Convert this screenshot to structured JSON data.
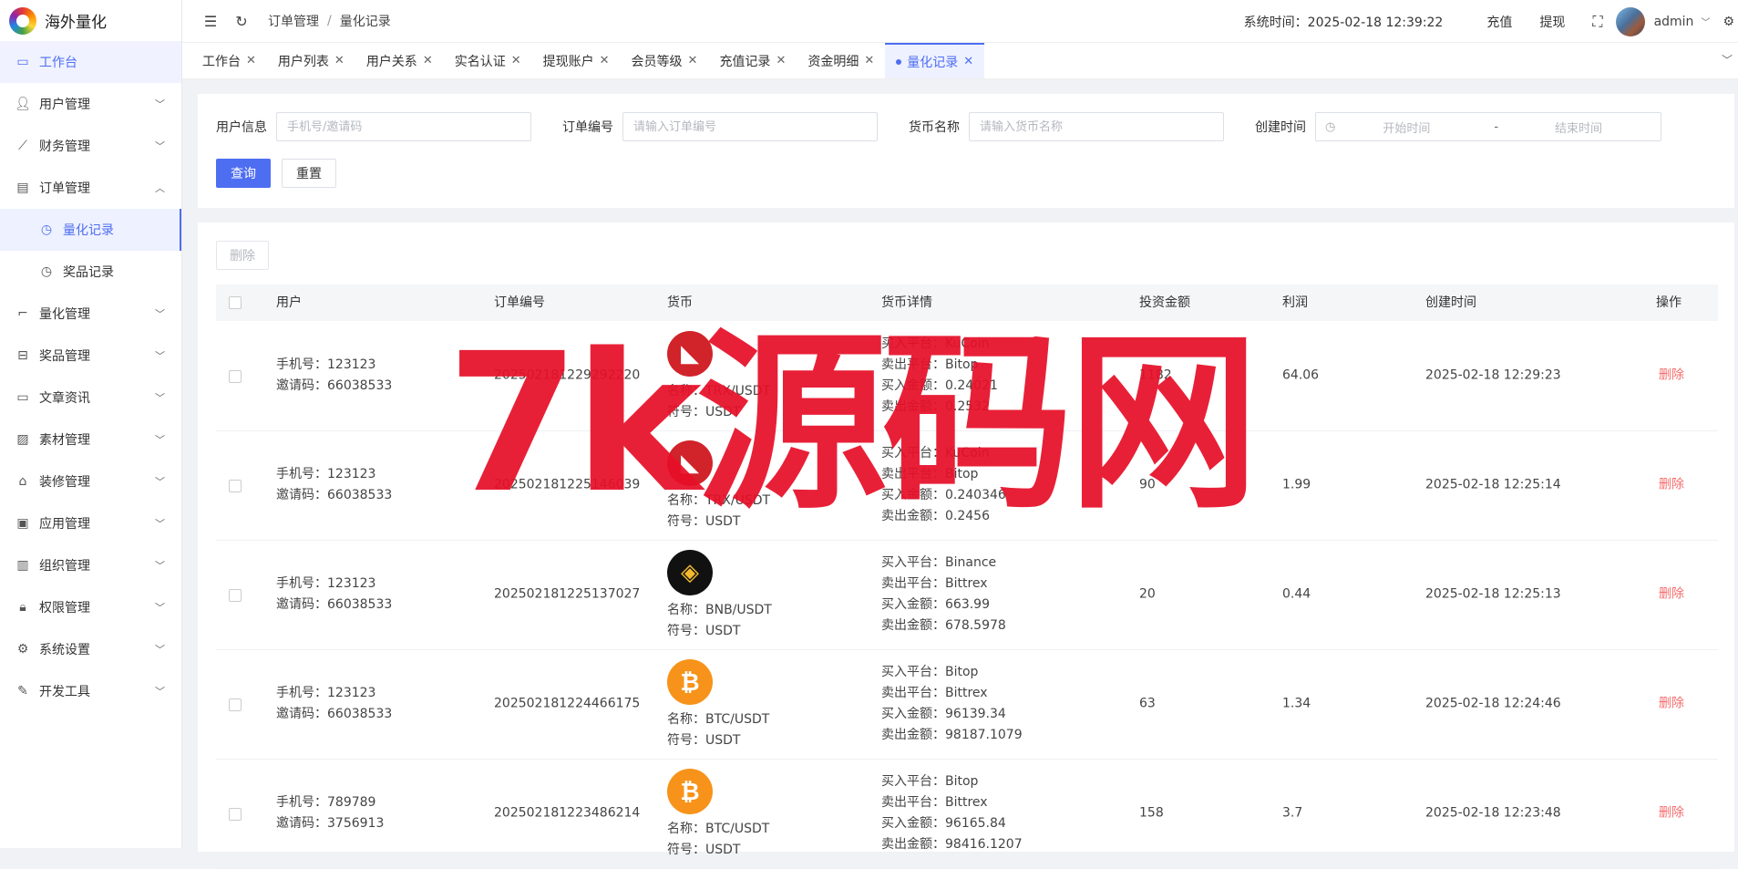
{
  "app": {
    "title": "海外量化"
  },
  "sidebar": {
    "items": [
      {
        "label": "工作台",
        "icon": "monitor-icon"
      },
      {
        "label": "用户管理",
        "icon": "user-icon"
      },
      {
        "label": "财务管理",
        "icon": "chart-icon"
      },
      {
        "label": "订单管理",
        "icon": "order-icon",
        "expanded": true,
        "children": [
          {
            "label": "量化记录",
            "icon": "clock-icon",
            "selected": true
          },
          {
            "label": "奖品记录",
            "icon": "clock-icon"
          }
        ]
      },
      {
        "label": "量化管理",
        "icon": "quant-icon"
      },
      {
        "label": "奖品管理",
        "icon": "gift-icon"
      },
      {
        "label": "文章资讯",
        "icon": "article-icon"
      },
      {
        "label": "素材管理",
        "icon": "image-icon"
      },
      {
        "label": "装修管理",
        "icon": "decorate-icon"
      },
      {
        "label": "应用管理",
        "icon": "app-icon"
      },
      {
        "label": "组织管理",
        "icon": "org-icon"
      },
      {
        "label": "权限管理",
        "icon": "lock-icon"
      },
      {
        "label": "系统设置",
        "icon": "gear-icon"
      },
      {
        "label": "开发工具",
        "icon": "tool-icon"
      }
    ]
  },
  "header": {
    "breadcrumb": [
      "订单管理",
      "量化记录"
    ],
    "breadcrumb_sep": "/",
    "system_time": "系统时间：2025-02-18 12:39:22",
    "recharge": "充值",
    "withdraw": "提现",
    "user": "admin"
  },
  "tabs": [
    "工作台",
    "用户列表",
    "用户关系",
    "实名认证",
    "提现账户",
    "会员等级",
    "充值记录",
    "资金明细",
    "量化记录"
  ],
  "search": {
    "user_label": "用户信息",
    "user_placeholder": "手机号/邀请码",
    "order_label": "订单编号",
    "order_placeholder": "请输入订单编号",
    "coin_label": "货币名称",
    "coin_placeholder": "请输入货币名称",
    "time_label": "创建时间",
    "time_start": "开始时间",
    "time_sep": "-",
    "time_end": "结束时间",
    "query_btn": "查询",
    "reset_btn": "重置"
  },
  "table": {
    "delete_btn": "删除",
    "columns": [
      "用户",
      "订单编号",
      "货币",
      "货币详情",
      "投资金额",
      "利润",
      "创建时间",
      "操作"
    ],
    "rows": [
      {
        "phone": "手机号：123123",
        "invite": "邀请码：66038533",
        "order_no": "202502181229292220",
        "coin_icon": "tron-icon",
        "coin_name": "名称：TRX/USDT",
        "coin_symbol": "符号：USDT",
        "buy_platform": "买入平台：KuCoin",
        "sell_platform": "卖出平台：Bitop",
        "buy_amount": "买入金额：0.24021",
        "sell_amount": "卖出金额：0.2532",
        "invest": "1182",
        "profit": "64.06",
        "created": "2025-02-18 12:29:23",
        "action": "删除"
      },
      {
        "phone": "手机号：123123",
        "invite": "邀请码：66038533",
        "order_no": "202502181225146039",
        "coin_icon": "tron-icon",
        "coin_name": "名称：TRX/USDT",
        "coin_symbol": "符号：USDT",
        "buy_platform": "买入平台：KuCoin",
        "sell_platform": "卖出平台：Bitop",
        "buy_amount": "买入金额：0.240346",
        "sell_amount": "卖出金额：0.2456",
        "invest": "90",
        "profit": "1.99",
        "created": "2025-02-18 12:25:14",
        "action": "删除"
      },
      {
        "phone": "手机号：123123",
        "invite": "邀请码：66038533",
        "order_no": "202502181225137027",
        "coin_icon": "bnb-icon",
        "coin_name": "名称：BNB/USDT",
        "coin_symbol": "符号：USDT",
        "buy_platform": "买入平台：Binance",
        "sell_platform": "卖出平台：Bittrex",
        "buy_amount": "买入金额：663.99",
        "sell_amount": "卖出金额：678.5978",
        "invest": "20",
        "profit": "0.44",
        "created": "2025-02-18 12:25:13",
        "action": "删除"
      },
      {
        "phone": "手机号：123123",
        "invite": "邀请码：66038533",
        "order_no": "202502181224466175",
        "coin_icon": "bitcoin-icon",
        "coin_name": "名称：BTC/USDT",
        "coin_symbol": "符号：USDT",
        "buy_platform": "买入平台：Bitop",
        "sell_platform": "卖出平台：Bittrex",
        "buy_amount": "买入金额：96139.34",
        "sell_amount": "卖出金额：98187.1079",
        "invest": "63",
        "profit": "1.34",
        "created": "2025-02-18 12:24:46",
        "action": "删除"
      },
      {
        "phone": "手机号：789789",
        "invite": "邀请码：3756913",
        "order_no": "202502181223486214",
        "coin_icon": "bitcoin-icon",
        "coin_name": "名称：BTC/USDT",
        "coin_symbol": "符号：USDT",
        "buy_platform": "买入平台：Bitop",
        "sell_platform": "卖出平台：Bittrex",
        "buy_amount": "买入金额：96165.84",
        "sell_amount": "卖出金额：98416.1207",
        "invest": "158",
        "profit": "3.7",
        "created": "2025-02-18 12:23:48",
        "action": "删除"
      }
    ]
  },
  "watermark": "7k源码网",
  "colors": {
    "primary": "#4e6ef2",
    "danger": "#f56c6c",
    "watermark": "#e60f28"
  }
}
